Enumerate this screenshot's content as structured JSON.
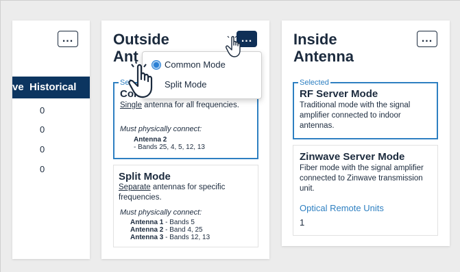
{
  "more_label": "...",
  "left_panel": {
    "col_header_partial": "ve",
    "col_header": "Historical",
    "values": [
      "0",
      "0",
      "0",
      "0"
    ]
  },
  "outside": {
    "title_line1": "Outside",
    "title_line2_visible": "Ant",
    "selected_label_visible": "Sel",
    "common": {
      "title_visible": "Con",
      "desc_u": "Single",
      "desc_rest": "antenna for all frequencies.",
      "must": "Must physically connect:",
      "antenna": "Antenna 2",
      "bands": "- Bands 25, 4, 5, 12, 13"
    },
    "split": {
      "title": "Split Mode",
      "desc_u": "Separate",
      "desc_rest": "antennas for specific frequencies.",
      "must": "Must physically connect:",
      "antennas": [
        {
          "name": "Antenna 1",
          "bands": "- Bands 5"
        },
        {
          "name": "Antenna 2",
          "bands": "- Band 4, 25"
        },
        {
          "name": "Antenna 3",
          "bands": "- Bands 12, 13"
        }
      ]
    }
  },
  "menu": {
    "items": [
      {
        "label": "Common Mode",
        "selected": true
      },
      {
        "label": "Split Mode",
        "selected": false
      }
    ]
  },
  "inside": {
    "title_line1": "Inside",
    "title_line2": "Antenna",
    "selected_label": "Selected",
    "rf": {
      "title": "RF Server Mode",
      "desc": "Traditional mode with the signal amplifier connected to indoor antennas."
    },
    "zinwave": {
      "title": "Zinwave Server Mode",
      "desc": "Fiber mode with the signal amplifier connected to Zinwave transmission unit.",
      "link": "Optical Remote Units",
      "value": "1"
    }
  },
  "colors": {
    "navy": "#0c3560",
    "accent_blue": "#2d7fc1",
    "radio_blue": "#2a7fd4"
  }
}
